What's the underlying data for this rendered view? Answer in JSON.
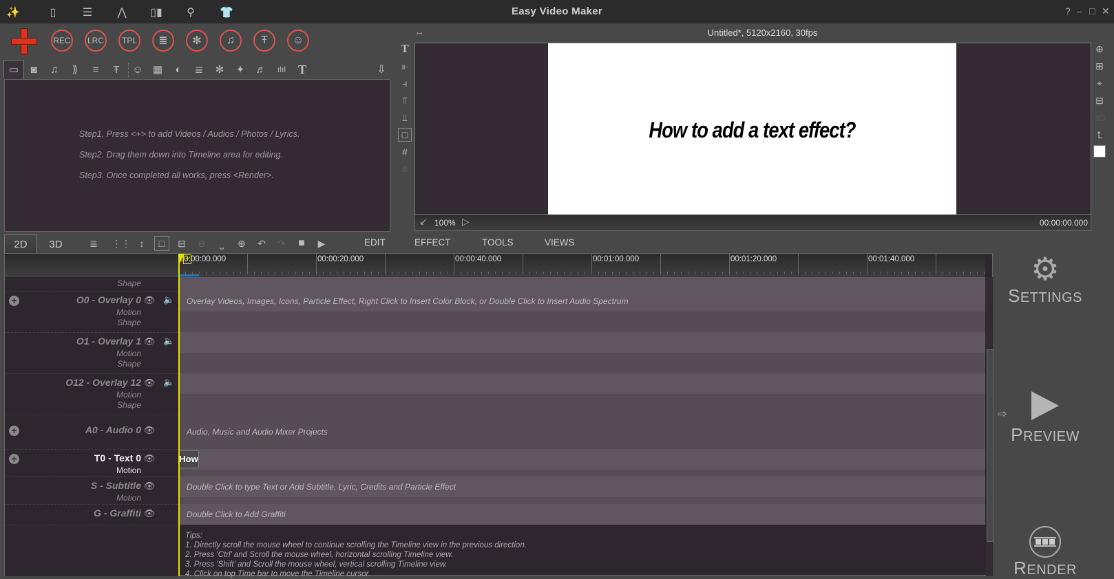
{
  "window": {
    "title": "Easy Video Maker",
    "controls": [
      "?",
      "–",
      "□",
      "✕"
    ]
  },
  "top_icons": [
    "app-logo-icon",
    "door-icon",
    "list-icon",
    "compass-icon",
    "columns-icon",
    "search-icon",
    "tshirt-icon"
  ],
  "toolbar": {
    "add_label": "+",
    "circle_buttons": [
      "REC",
      "LRC",
      "TPL",
      "≣",
      "✻",
      "♫",
      "Ŧ",
      "☺"
    ]
  },
  "media_tabs": [
    "▭",
    "◙",
    "♫",
    "⟫",
    "≡",
    "Ŧ",
    "☺",
    "▦",
    "◐",
    "≣",
    "✻",
    "✦",
    "♬",
    "ılıl",
    "T"
  ],
  "library": {
    "steps": [
      "Step1. Press <+> to add Videos / Audios / Photos / Lyrics.",
      "Step2. Drag them down into Timeline area for editing.",
      "Step3. Once completed all works, press <Render>."
    ]
  },
  "preview": {
    "title": "Untitled*, 5120x2160, 30fps",
    "canvas_text": "How to add a text effect?",
    "zoom": "100%",
    "timecode": "00:00:00.000"
  },
  "timeline": {
    "tabs": [
      "2D",
      "3D"
    ],
    "menus": [
      "EDIT",
      "EFFECT",
      "TOOLS",
      "VIEWS"
    ],
    "ruler_labels": [
      "00:00:00.000",
      "00:00:20.000",
      "00:00:40.000",
      "00:01:00.000",
      "00:01:20.000",
      "00:01:40.000"
    ],
    "top_partial_sub": "Shape",
    "tracks": [
      {
        "name": "O0 - Overlay 0",
        "subs": [
          "Motion",
          "Shape"
        ],
        "hint": "Overlay Videos, Images, Icons, Particle Effect, Right Click to Insert Color Block, or Double  Click to Insert Audio Spectrum"
      },
      {
        "name": "O1 - Overlay 1",
        "subs": [
          "Motion",
          "Shape"
        ],
        "hint": ""
      },
      {
        "name": "O12 - Overlay 12",
        "subs": [
          "Motion",
          "Shape"
        ],
        "hint": ""
      },
      {
        "name": "A0 - Audio 0",
        "subs": [],
        "hint": "Audio, Music and Audio Mixer Projects"
      },
      {
        "name": "T0 - Text 0",
        "subs": [
          "Motion"
        ],
        "hint": "",
        "clip": "How"
      },
      {
        "name": "S - Subtitle",
        "subs": [
          "Motion"
        ],
        "hint": "Double Click to type Text or Add Subtitle, Lyric, Credits and Particle Effect"
      },
      {
        "name": "G - Graffiti",
        "subs": [],
        "hint": "Double Click to Add Graffiti"
      }
    ],
    "tips": [
      "Tips:",
      "1. Directly scroll the mouse wheel to continue scrolling the Timeline view in the previous direction.",
      "2. Press 'Ctrl' and Scroll the mouse wheel, horizontal scrolling Timeline view.",
      "3. Press 'Shift' and Scroll the mouse wheel, vertical scrolling Timeline view.",
      "4. Click on top Time bar to move the Timeline cursor."
    ]
  },
  "actions": {
    "settings": {
      "cap": "S",
      "rest": "ETTINGS"
    },
    "preview": {
      "cap": "P",
      "rest": "REVIEW"
    },
    "render": {
      "cap": "R",
      "rest": "ENDER"
    }
  },
  "colors": {
    "accent_red": "#d9554a",
    "cursor_yellow": "#e8e000",
    "panel_bg": "#332a33",
    "lane_bg": "#5f565f"
  }
}
